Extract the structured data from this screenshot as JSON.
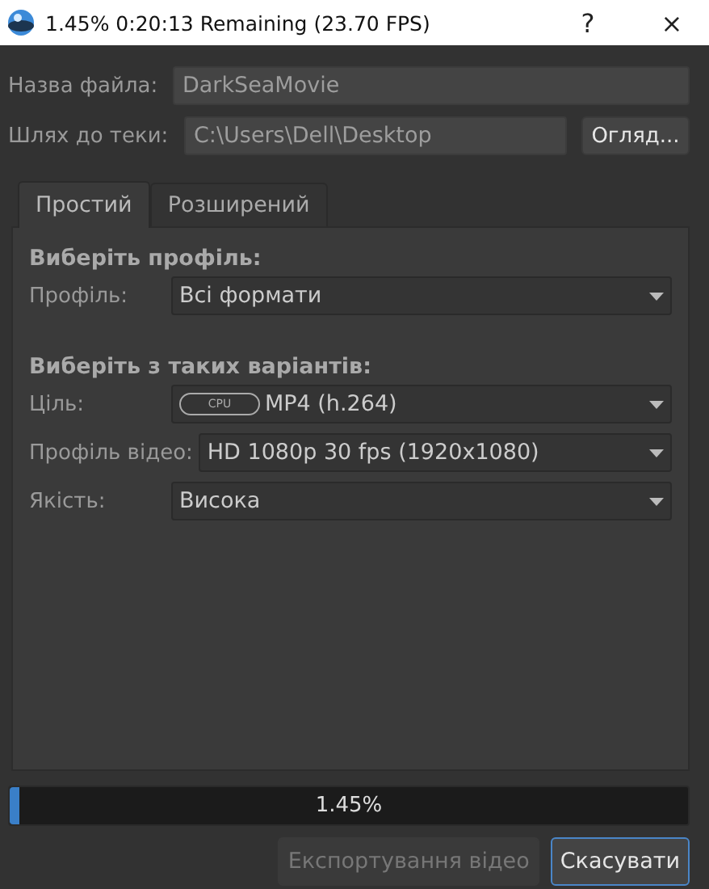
{
  "window": {
    "title": "1.45%  0:20:13 Remaining (23.70 FPS)",
    "help": "?",
    "close": "×"
  },
  "file_name": {
    "label": "Назва файла:",
    "value": "DarkSeaMovie",
    "disabled": true
  },
  "folder_path": {
    "label": "Шлях до теки:",
    "value": "C:\\Users\\Dell\\Desktop",
    "disabled": true,
    "browse": "Огляд..."
  },
  "tabs": [
    {
      "label": "Простий",
      "selected": true
    },
    {
      "label": "Розширений",
      "selected": false
    }
  ],
  "sections": [
    {
      "heading": "Виберіть профіль:",
      "rows": [
        {
          "label": "Профіль:",
          "value": "Всі формати"
        }
      ]
    },
    {
      "heading": "Виберіть з таких варіантів:",
      "rows": [
        {
          "label": "Ціль:",
          "badge": "CPU",
          "value": "MP4 (h.264)"
        },
        {
          "label": "Профіль відео:",
          "value": "HD 1080p 30 fps (1920x1080)"
        },
        {
          "label": "Якість:",
          "value": "Висока"
        }
      ]
    }
  ],
  "progress": {
    "level": 0.0145,
    "reading": "1.45%"
  },
  "buttons": [
    {
      "label": "Експортування відео",
      "disabled": true,
      "focused": false
    },
    {
      "label": "Скасувати",
      "disabled": false,
      "focused": true
    }
  ]
}
